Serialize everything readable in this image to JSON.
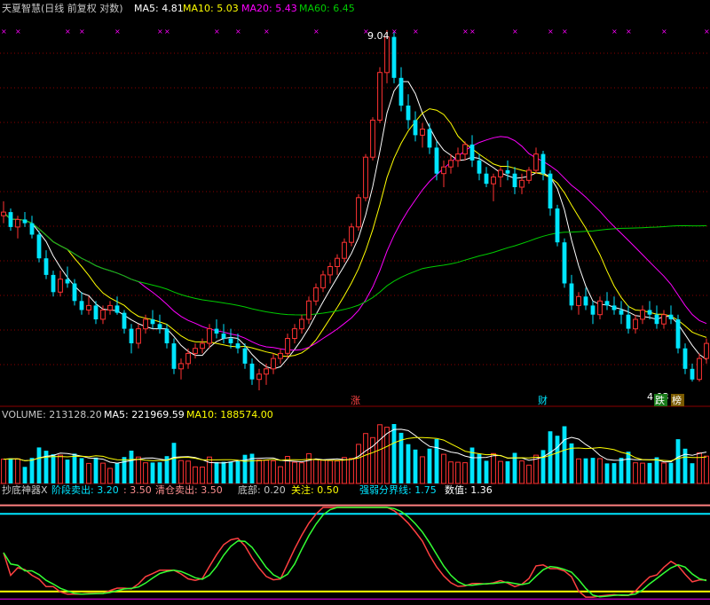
{
  "header": {
    "title": "天夏智慧(日线 前复权 对数)",
    "ma5": "MA5: 4.81",
    "ma10": "MA10: 5.03",
    "ma20": "MA20: 5.43",
    "ma60": "MA60: 6.45"
  },
  "price_panel": {
    "high_label": "9.04",
    "low_label": "4.03",
    "tags": [
      "涨",
      "财",
      "跌",
      "榜"
    ]
  },
  "volume_panel": {
    "volume": "VOLUME: 213128.20",
    "ma5": "MA5: 221969.59",
    "ma10": "MA10: 188574.00"
  },
  "indicator_panel": {
    "name": "抄底神器X",
    "stage_sell": "阶段卖出: 3.20",
    "stage_sell_2": ": 3.50",
    "clear_sell": "清仓卖出: 3.50",
    "bottom": "底部: 0.20",
    "watch": "关注: 0.50",
    "strength_line": "强弱分界线: 1.75",
    "value": "数值: 1.36"
  },
  "colors": {
    "up": "#ff3232",
    "down": "#00e5ff",
    "ma5": "#ffffff",
    "ma10": "#ffff00",
    "ma20": "#ff00ff",
    "ma60": "#00cc00",
    "grid": "#8b0000"
  },
  "chart_data": {
    "type": "candlestick",
    "candles": [
      [
        5.9,
        6.1,
        5.8,
        5.95
      ],
      [
        5.95,
        6.0,
        5.7,
        5.75
      ],
      [
        5.75,
        5.9,
        5.6,
        5.85
      ],
      [
        5.85,
        5.95,
        5.75,
        5.8
      ],
      [
        5.8,
        5.9,
        5.6,
        5.65
      ],
      [
        5.65,
        5.7,
        5.3,
        5.35
      ],
      [
        5.35,
        5.45,
        5.1,
        5.15
      ],
      [
        5.15,
        5.2,
        4.9,
        4.95
      ],
      [
        4.95,
        5.2,
        4.9,
        5.1
      ],
      [
        5.1,
        5.25,
        5.0,
        5.05
      ],
      [
        5.05,
        5.1,
        4.8,
        4.85
      ],
      [
        4.85,
        4.95,
        4.7,
        4.75
      ],
      [
        4.75,
        4.9,
        4.7,
        4.8
      ],
      [
        4.8,
        4.85,
        4.6,
        4.65
      ],
      [
        4.65,
        4.8,
        4.6,
        4.75
      ],
      [
        4.75,
        4.85,
        4.7,
        4.8
      ],
      [
        4.8,
        4.9,
        4.7,
        4.72
      ],
      [
        4.72,
        4.75,
        4.5,
        4.55
      ],
      [
        4.55,
        4.6,
        4.3,
        4.4
      ],
      [
        4.4,
        4.6,
        4.35,
        4.55
      ],
      [
        4.55,
        4.7,
        4.5,
        4.65
      ],
      [
        4.65,
        4.75,
        4.55,
        4.6
      ],
      [
        4.6,
        4.7,
        4.5,
        4.55
      ],
      [
        4.55,
        4.6,
        4.35,
        4.4
      ],
      [
        4.4,
        4.45,
        4.1,
        4.15
      ],
      [
        4.15,
        4.25,
        4.05,
        4.2
      ],
      [
        4.2,
        4.35,
        4.15,
        4.3
      ],
      [
        4.3,
        4.4,
        4.25,
        4.35
      ],
      [
        4.35,
        4.45,
        4.3,
        4.4
      ],
      [
        4.4,
        4.6,
        4.35,
        4.55
      ],
      [
        4.55,
        4.65,
        4.45,
        4.5
      ],
      [
        4.5,
        4.6,
        4.4,
        4.45
      ],
      [
        4.45,
        4.55,
        4.35,
        4.4
      ],
      [
        4.4,
        4.5,
        4.3,
        4.35
      ],
      [
        4.35,
        4.4,
        4.15,
        4.2
      ],
      [
        4.2,
        4.25,
        4.0,
        4.05
      ],
      [
        4.05,
        4.15,
        3.95,
        4.1
      ],
      [
        4.1,
        4.2,
        4.0,
        4.15
      ],
      [
        4.15,
        4.3,
        4.1,
        4.25
      ],
      [
        4.25,
        4.35,
        4.2,
        4.3
      ],
      [
        4.3,
        4.5,
        4.25,
        4.45
      ],
      [
        4.45,
        4.6,
        4.4,
        4.55
      ],
      [
        4.55,
        4.7,
        4.5,
        4.65
      ],
      [
        4.65,
        4.9,
        4.6,
        4.85
      ],
      [
        4.85,
        5.05,
        4.8,
        5.0
      ],
      [
        5.0,
        5.2,
        4.95,
        5.15
      ],
      [
        5.15,
        5.3,
        5.05,
        5.25
      ],
      [
        5.25,
        5.4,
        5.15,
        5.35
      ],
      [
        5.35,
        5.6,
        5.3,
        5.55
      ],
      [
        5.55,
        5.8,
        5.5,
        5.75
      ],
      [
        5.75,
        6.2,
        5.7,
        6.15
      ],
      [
        6.15,
        6.8,
        6.1,
        6.75
      ],
      [
        6.75,
        7.4,
        6.7,
        7.35
      ],
      [
        7.35,
        8.3,
        7.3,
        8.2
      ],
      [
        8.2,
        9.04,
        8.0,
        8.9
      ],
      [
        8.9,
        9.0,
        8.0,
        8.1
      ],
      [
        8.1,
        8.3,
        7.5,
        7.6
      ],
      [
        7.6,
        7.8,
        7.2,
        7.35
      ],
      [
        7.35,
        7.5,
        7.0,
        7.1
      ],
      [
        7.1,
        7.3,
        6.9,
        7.2
      ],
      [
        7.2,
        7.3,
        6.8,
        6.9
      ],
      [
        6.9,
        7.0,
        6.4,
        6.5
      ],
      [
        6.5,
        6.7,
        6.3,
        6.6
      ],
      [
        6.6,
        6.8,
        6.5,
        6.7
      ],
      [
        6.7,
        6.9,
        6.6,
        6.8
      ],
      [
        6.8,
        7.0,
        6.7,
        6.95
      ],
      [
        6.95,
        7.1,
        6.6,
        6.7
      ],
      [
        6.7,
        6.8,
        6.4,
        6.5
      ],
      [
        6.5,
        6.6,
        6.3,
        6.35
      ],
      [
        6.35,
        6.5,
        6.1,
        6.45
      ],
      [
        6.45,
        6.6,
        6.3,
        6.55
      ],
      [
        6.55,
        6.7,
        6.4,
        6.5
      ],
      [
        6.5,
        6.6,
        6.2,
        6.3
      ],
      [
        6.3,
        6.5,
        6.2,
        6.4
      ],
      [
        6.4,
        6.6,
        6.35,
        6.55
      ],
      [
        6.55,
        6.9,
        6.5,
        6.8
      ],
      [
        6.8,
        6.85,
        6.4,
        6.5
      ],
      [
        6.5,
        6.55,
        5.9,
        6.0
      ],
      [
        6.0,
        6.05,
        5.5,
        5.55
      ],
      [
        5.55,
        5.6,
        5.0,
        5.05
      ],
      [
        5.05,
        5.15,
        4.75,
        4.8
      ],
      [
        4.8,
        4.95,
        4.7,
        4.9
      ],
      [
        4.9,
        5.0,
        4.75,
        4.8
      ],
      [
        4.8,
        4.85,
        4.6,
        4.7
      ],
      [
        4.7,
        4.9,
        4.65,
        4.85
      ],
      [
        4.85,
        4.95,
        4.75,
        4.8
      ],
      [
        4.8,
        4.9,
        4.7,
        4.75
      ],
      [
        4.75,
        4.85,
        4.6,
        4.7
      ],
      [
        4.7,
        4.8,
        4.5,
        4.55
      ],
      [
        4.55,
        4.7,
        4.5,
        4.65
      ],
      [
        4.65,
        4.8,
        4.6,
        4.75
      ],
      [
        4.75,
        4.85,
        4.65,
        4.7
      ],
      [
        4.7,
        4.8,
        4.55,
        4.6
      ],
      [
        4.6,
        4.75,
        4.55,
        4.7
      ],
      [
        4.7,
        4.8,
        4.6,
        4.65
      ],
      [
        4.65,
        4.7,
        4.3,
        4.35
      ],
      [
        4.35,
        4.4,
        4.1,
        4.15
      ],
      [
        4.15,
        4.2,
        4.03,
        4.05
      ],
      [
        4.05,
        4.3,
        4.03,
        4.25
      ],
      [
        4.25,
        4.45,
        4.2,
        4.4
      ]
    ],
    "price_range_log": [
      3.95,
      9.3
    ]
  }
}
